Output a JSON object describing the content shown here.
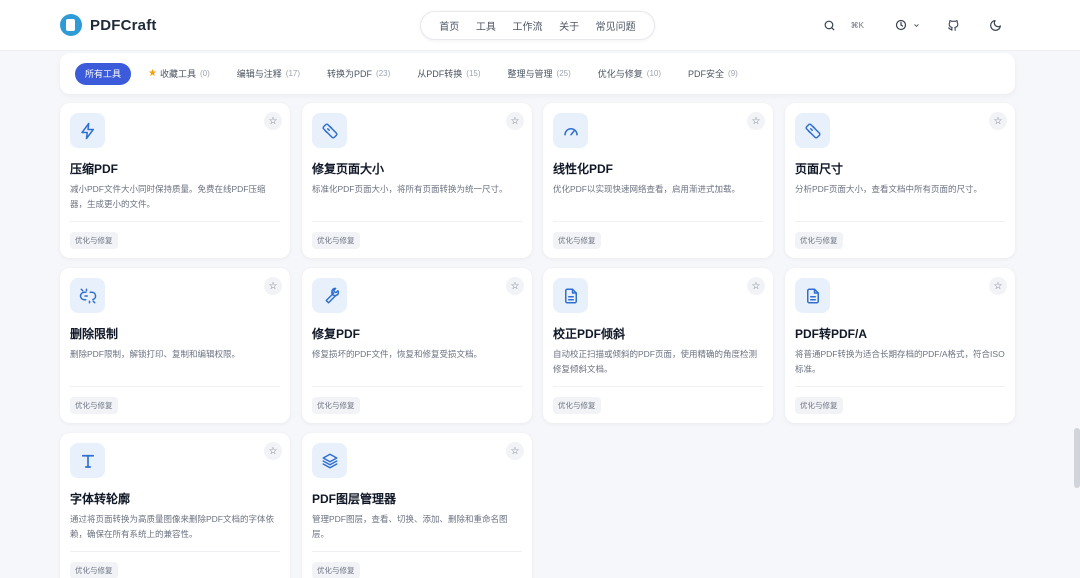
{
  "app": {
    "name": "PDFCraft"
  },
  "nav": {
    "items": [
      "首页",
      "工具",
      "工作流",
      "关于",
      "常见问题"
    ]
  },
  "header": {
    "shortcut": "⌘K"
  },
  "filters": [
    {
      "label": "所有工具",
      "count": "",
      "active": true
    },
    {
      "label": "收藏工具",
      "count": "(0)",
      "star": true
    },
    {
      "label": "编辑与注释",
      "count": "(17)"
    },
    {
      "label": "转换为PDF",
      "count": "(23)"
    },
    {
      "label": "从PDF转换",
      "count": "(15)"
    },
    {
      "label": "整理与管理",
      "count": "(25)"
    },
    {
      "label": "优化与修复",
      "count": "(10)"
    },
    {
      "label": "PDF安全",
      "count": "(9)"
    }
  ],
  "cards": [
    {
      "title": "压缩PDF",
      "desc": "减小PDF文件大小同时保持质量。免费在线PDF压缩器，生成更小的文件。",
      "tag": "优化与修复",
      "icon": "bolt-icon"
    },
    {
      "title": "修复页面大小",
      "desc": "标准化PDF页面大小，将所有页面转换为统一尺寸。",
      "tag": "优化与修复",
      "icon": "ruler-icon"
    },
    {
      "title": "线性化PDF",
      "desc": "优化PDF以实现快速网络查看，启用渐进式加载。",
      "tag": "优化与修复",
      "icon": "gauge-icon"
    },
    {
      "title": "页面尺寸",
      "desc": "分析PDF页面大小，查看文档中所有页面的尺寸。",
      "tag": "优化与修复",
      "icon": "ruler-icon"
    },
    {
      "title": "删除限制",
      "desc": "删除PDF限制，解锁打印、复制和编辑权限。",
      "tag": "优化与修复",
      "icon": "broken-link-icon"
    },
    {
      "title": "修复PDF",
      "desc": "修复损坏的PDF文件，恢复和修复受损文档。",
      "tag": "优化与修复",
      "icon": "wrench-icon"
    },
    {
      "title": "校正PDF倾斜",
      "desc": "自动校正扫描或倾斜的PDF页面，使用精确的角度检测修复倾斜文档。",
      "tag": "优化与修复",
      "icon": "document-icon"
    },
    {
      "title": "PDF转PDF/A",
      "desc": "将普通PDF转换为适合长期存档的PDF/A格式，符合ISO标准。",
      "tag": "优化与修复",
      "icon": "document-icon"
    },
    {
      "title": "字体转轮廓",
      "desc": "通过将页面转换为高质量图像来删除PDF文档的字体依赖，确保在所有系统上的兼容性。",
      "tag": "优化与修复",
      "icon": "type-icon"
    },
    {
      "title": "PDF图层管理器",
      "desc": "管理PDF图层，查看、切换、添加、删除和重命名图层。",
      "tag": "优化与修复",
      "icon": "layers-icon"
    }
  ],
  "colors": {
    "accent": "#3b5bdb",
    "icon_bg": "#e8f1fb",
    "icon_stroke": "#2f6fd1",
    "star": "#f59e0b"
  }
}
